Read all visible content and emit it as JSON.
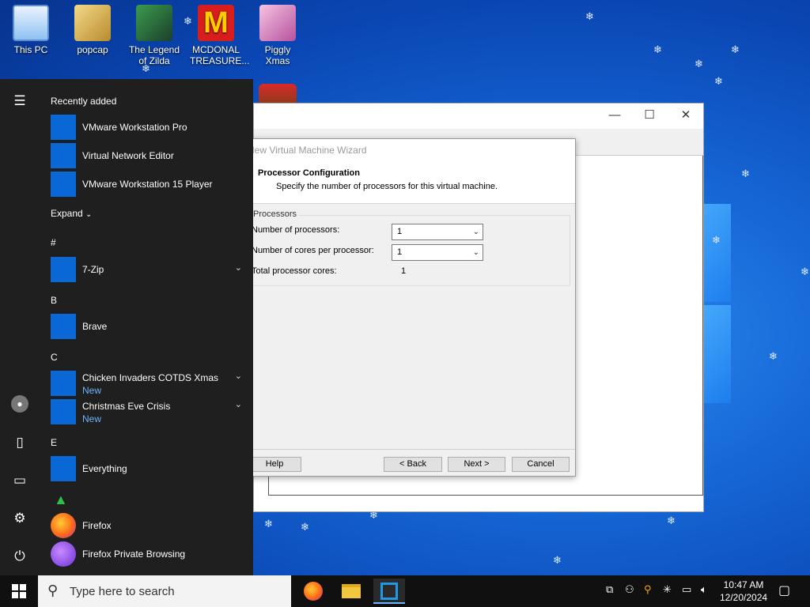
{
  "desktop_icons": [
    {
      "label": "This PC"
    },
    {
      "label": "popcap"
    },
    {
      "label": "The Legend of Zilda"
    },
    {
      "label": "MCDONAL TREASURE..."
    },
    {
      "label": "Piggly Xmas"
    }
  ],
  "wizard": {
    "title": "New Virtual Machine Wizard",
    "heading": "Processor Configuration",
    "subheading": "Specify the number of processors for this virtual machine.",
    "group_title": "Processors",
    "num_processors_label": "Number of processors:",
    "num_processors_value": "1",
    "cores_label": "Number of cores per processor:",
    "cores_value": "1",
    "total_label": "Total processor cores:",
    "total_value": "1",
    "help": "Help",
    "back": "< Back",
    "next": "Next >",
    "cancel": "Cancel"
  },
  "start_menu": {
    "recently_added": "Recently added",
    "expand": "Expand",
    "recent": [
      {
        "name": "VMware Workstation Pro"
      },
      {
        "name": "Virtual Network Editor"
      },
      {
        "name": "VMware Workstation 15 Player"
      }
    ],
    "letters": [
      "#",
      "B",
      "C",
      "E"
    ],
    "apps": {
      "seven_zip": "7-Zip",
      "brave": "Brave",
      "chicken": "Chicken Invaders COTDS Xmas",
      "chicken_sub": "New",
      "christmas": "Christmas Eve Crisis",
      "christmas_sub": "New",
      "everything": "Everything",
      "firefox": "Firefox",
      "firefox_private": "Firefox Private Browsing"
    }
  },
  "taskbar": {
    "search_placeholder": "Type here to search",
    "time": "10:47 AM",
    "date": "12/20/2024"
  },
  "colors": {
    "start_bg": "#1f1f1f",
    "accent_blue": "#0a68d6",
    "new_badge": "#6cb4ff"
  }
}
